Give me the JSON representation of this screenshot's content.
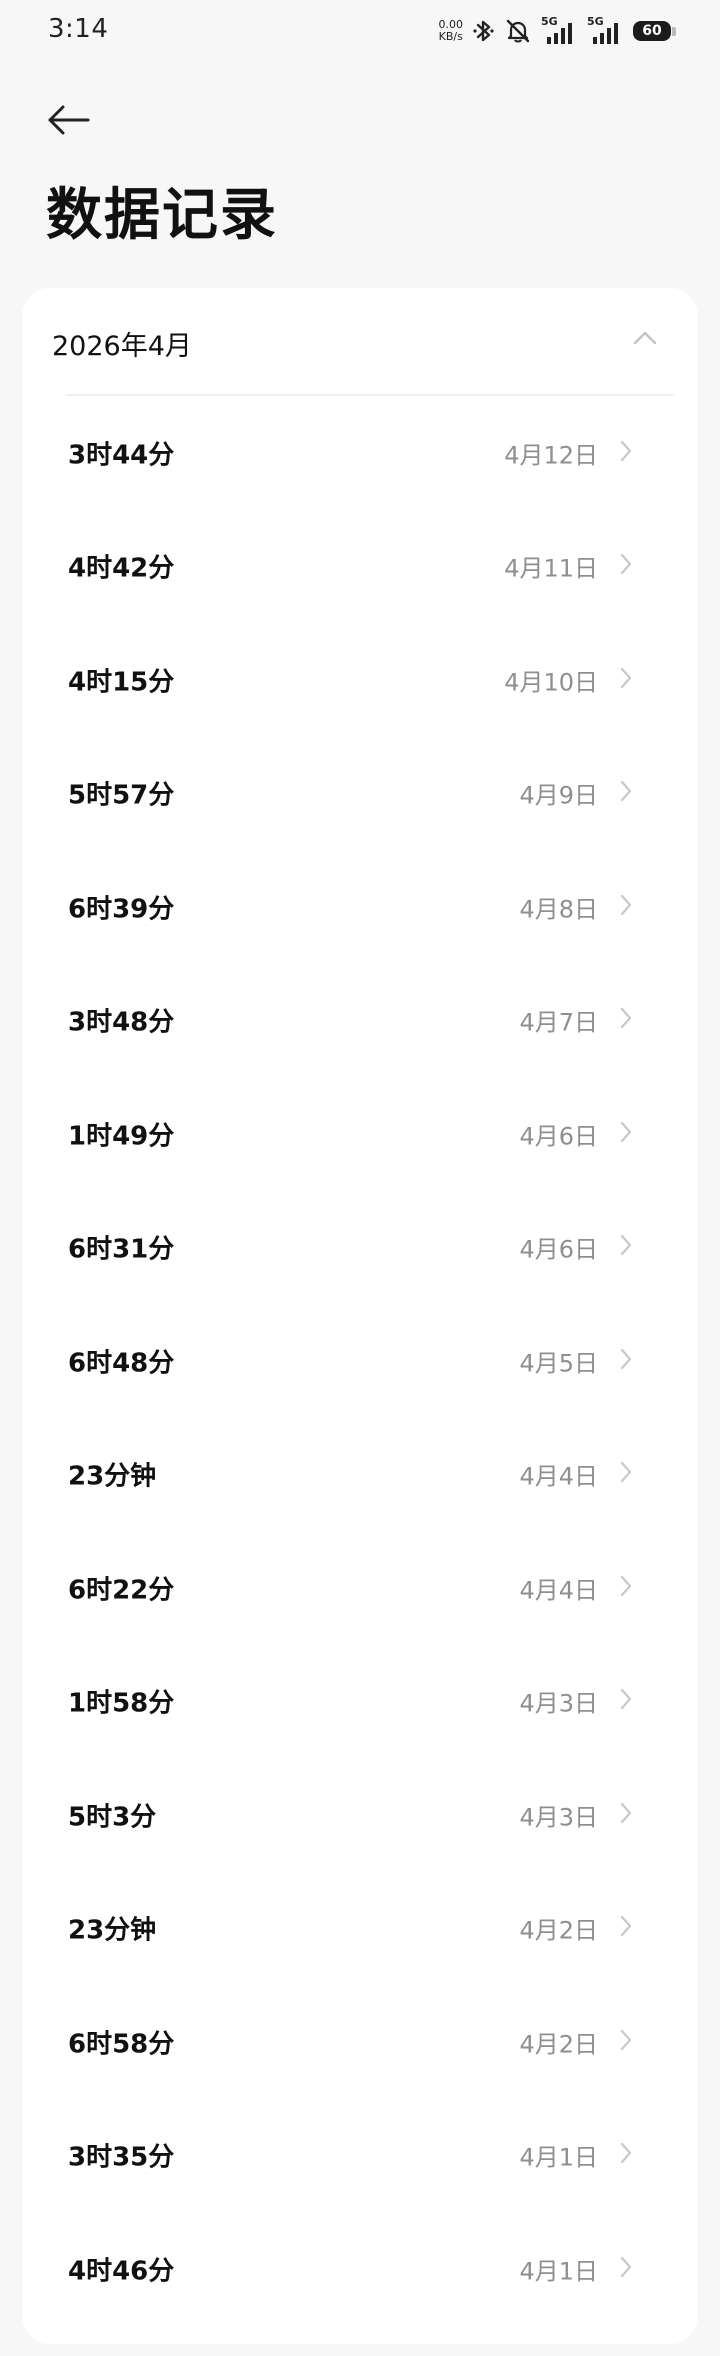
{
  "status_bar": {
    "time": "3:14",
    "net_speed_value": "0.00",
    "net_speed_unit": "KB/s",
    "sim1_gen": "5G",
    "sim2_gen": "5G",
    "battery": "60"
  },
  "header": {
    "title": "数据记录"
  },
  "group": {
    "month": "2026年4月"
  },
  "records": [
    {
      "duration": "3时44分",
      "date": "4月12日"
    },
    {
      "duration": "4时42分",
      "date": "4月11日"
    },
    {
      "duration": "4时15分",
      "date": "4月10日"
    },
    {
      "duration": "5时57分",
      "date": "4月9日"
    },
    {
      "duration": "6时39分",
      "date": "4月8日"
    },
    {
      "duration": "3时48分",
      "date": "4月7日"
    },
    {
      "duration": "1时49分",
      "date": "4月6日"
    },
    {
      "duration": "6时31分",
      "date": "4月6日"
    },
    {
      "duration": "6时48分",
      "date": "4月5日"
    },
    {
      "duration": "23分钟",
      "date": "4月4日"
    },
    {
      "duration": "6时22分",
      "date": "4月4日"
    },
    {
      "duration": "1时58分",
      "date": "4月3日"
    },
    {
      "duration": "5时3分",
      "date": "4月3日"
    },
    {
      "duration": "23分钟",
      "date": "4月2日"
    },
    {
      "duration": "6时58分",
      "date": "4月2日"
    },
    {
      "duration": "3时35分",
      "date": "4月1日"
    },
    {
      "duration": "4时46分",
      "date": "4月1日"
    }
  ],
  "icons": {
    "back": "arrow-left-icon",
    "collapse": "chevron-up-icon",
    "row": "chevron-right-icon",
    "bluetooth": "bluetooth-icon",
    "mute": "bell-off-icon",
    "signal": "signal-icon"
  },
  "colors": {
    "background": "#f7f7f7",
    "card": "#ffffff",
    "primary_text": "#111111",
    "secondary_text": "#8f8f8f",
    "chevron": "#c8c8c8"
  }
}
